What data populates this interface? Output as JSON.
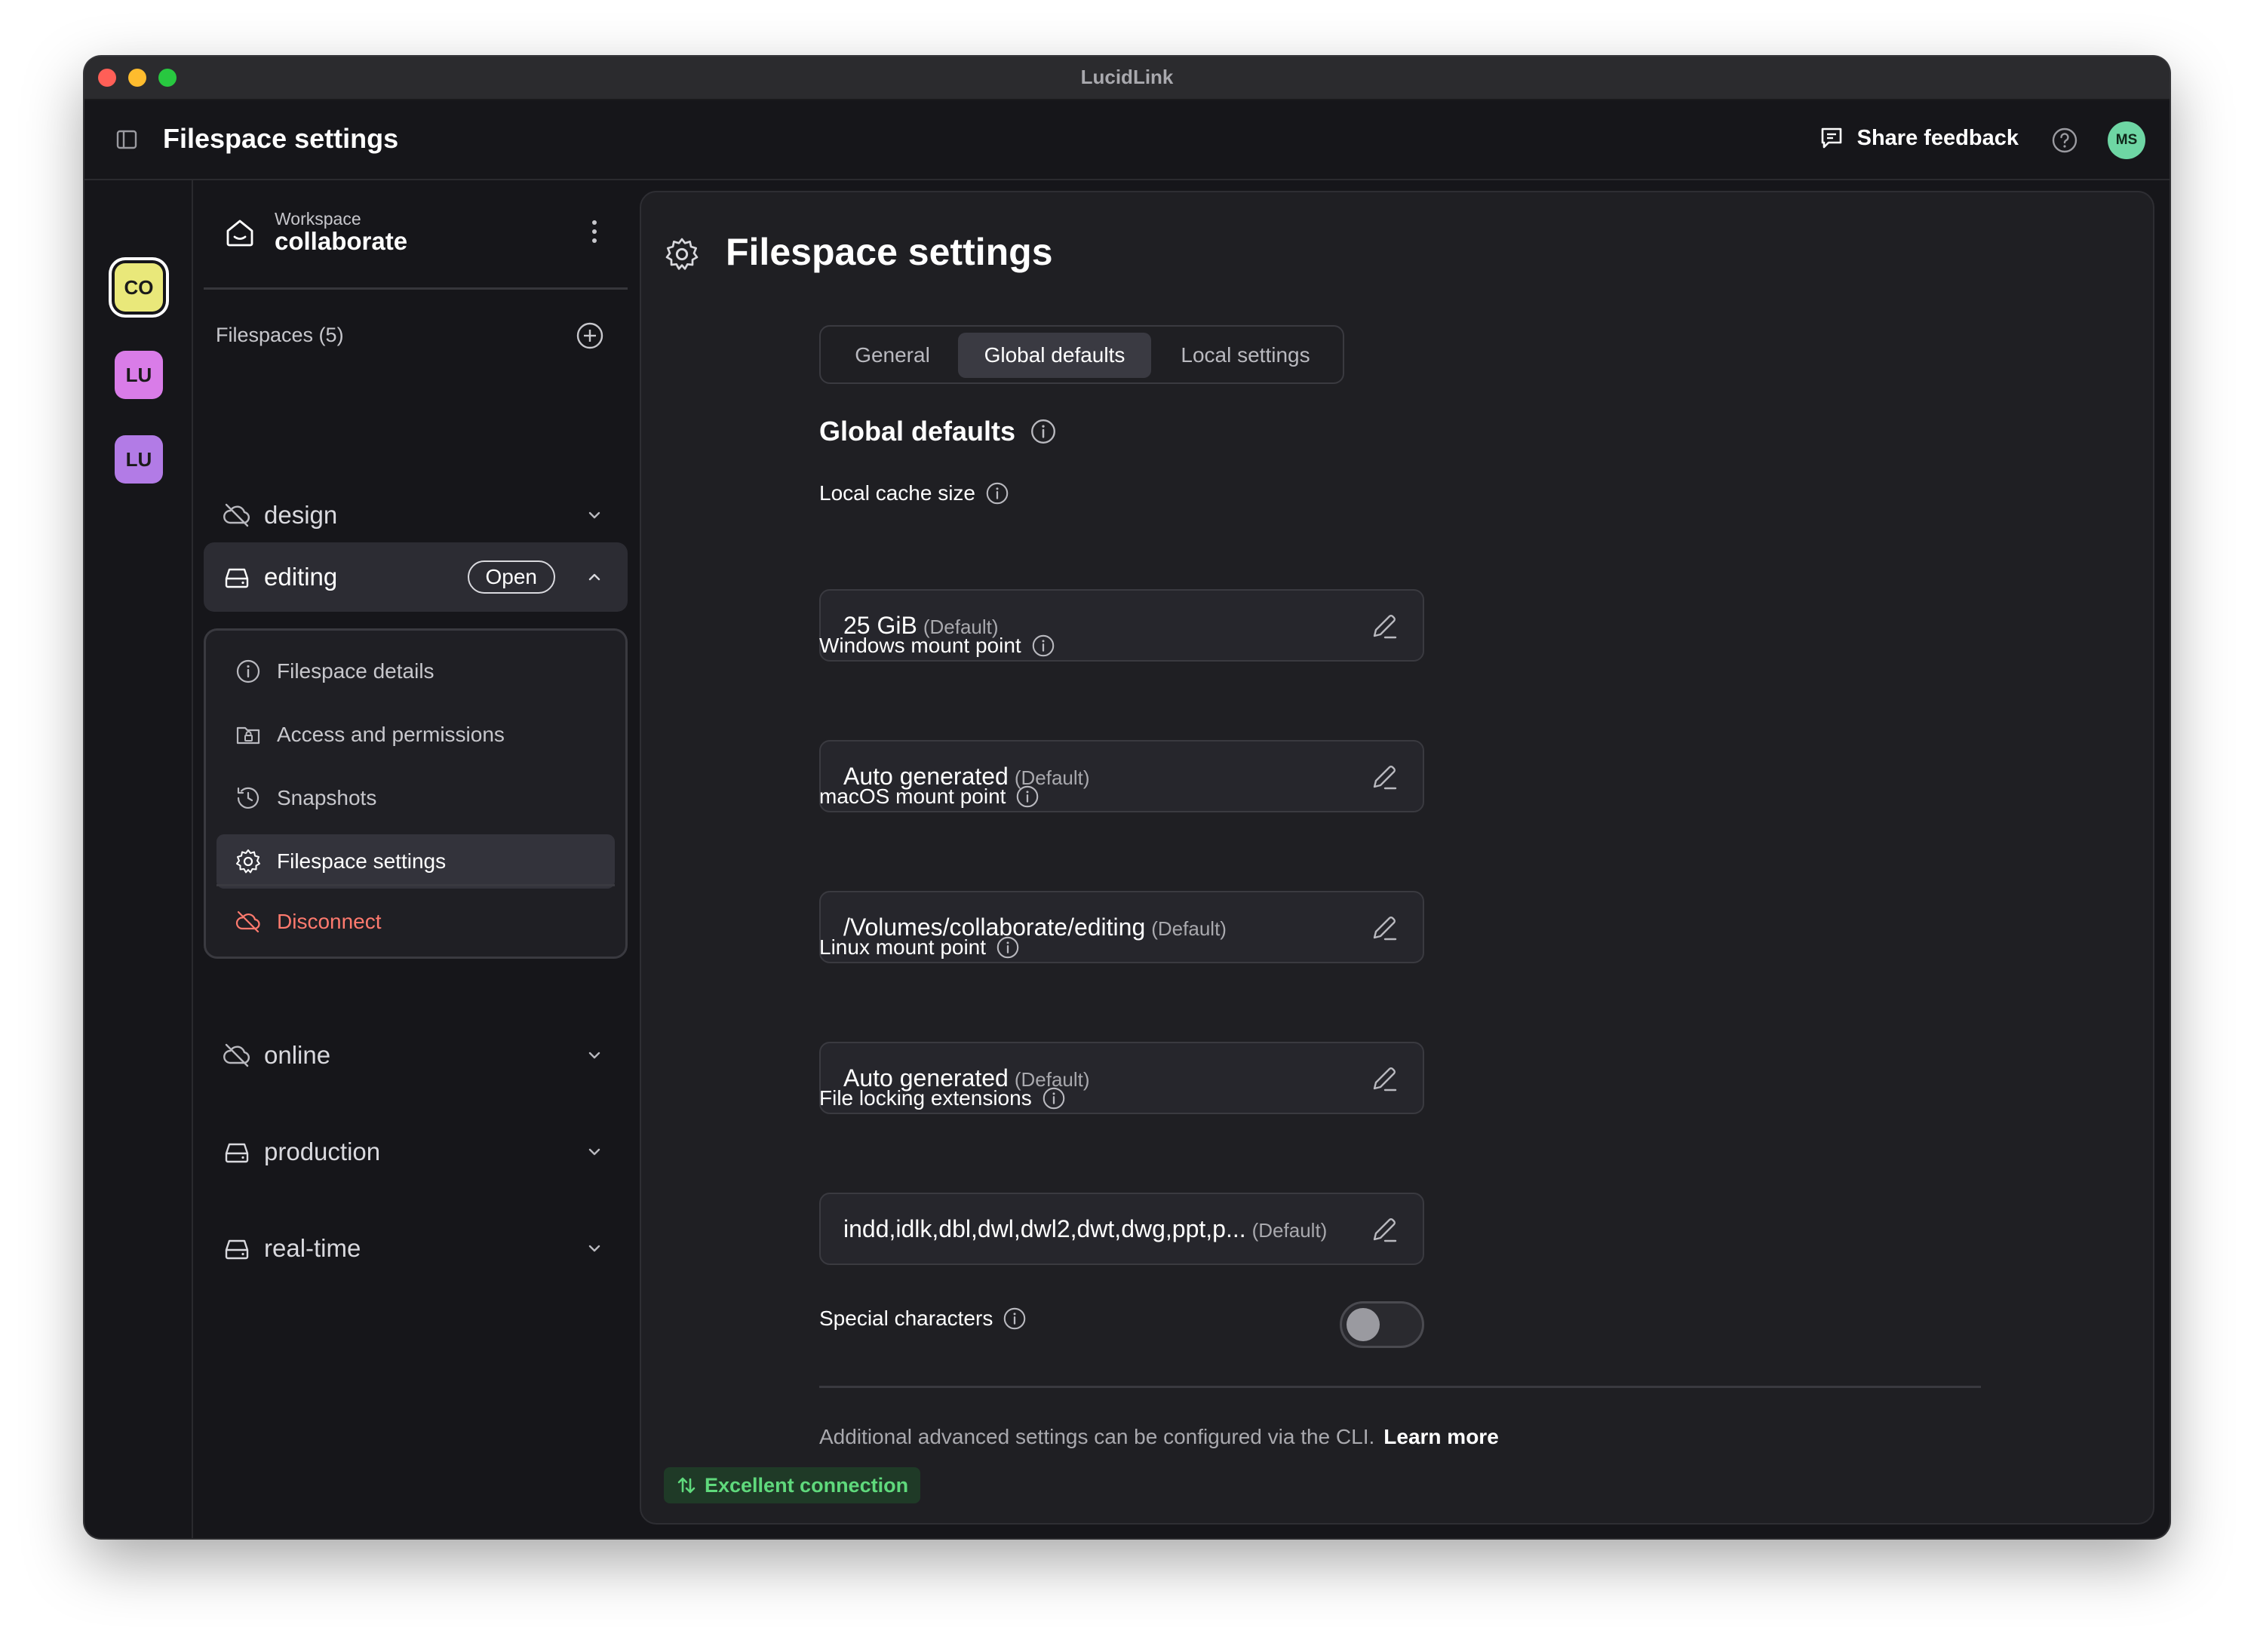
{
  "window": {
    "title": "LucidLink"
  },
  "header": {
    "title": "Filespace settings",
    "feedback_label": "Share feedback",
    "avatar_initials": "MS"
  },
  "workspaces": [
    {
      "initials": "CO",
      "color": "#e9e87a",
      "selected": true
    },
    {
      "initials": "LU",
      "color": "#d97ce8",
      "selected": false
    },
    {
      "initials": "LU",
      "color": "#b27be6",
      "selected": false
    }
  ],
  "sidebar": {
    "workspace_label": "Workspace",
    "workspace_name": "collaborate",
    "filespaces_label": "Filespaces (5)",
    "filespaces": [
      {
        "name": "design",
        "icon": "cloud-off-icon"
      },
      {
        "name": "editing",
        "icon": "drive-icon",
        "badge": "Open",
        "expanded": true
      },
      {
        "name": "online",
        "icon": "cloud-off-icon"
      },
      {
        "name": "production",
        "icon": "drive-icon"
      },
      {
        "name": "real-time",
        "icon": "drive-icon"
      }
    ],
    "submenu": [
      {
        "label": "Filespace details",
        "icon": "info-icon"
      },
      {
        "label": "Access and permissions",
        "icon": "folder-lock-icon"
      },
      {
        "label": "Snapshots",
        "icon": "clock-icon"
      },
      {
        "label": "Filespace settings",
        "icon": "gear-icon",
        "selected": true
      },
      {
        "label": "Disconnect",
        "icon": "cloud-off-icon",
        "danger": true
      }
    ]
  },
  "main": {
    "title": "Filespace settings",
    "tabs": [
      {
        "label": "General"
      },
      {
        "label": "Global defaults",
        "active": true
      },
      {
        "label": "Local settings"
      }
    ],
    "section_title": "Global defaults",
    "fields": [
      {
        "label": "Local cache size",
        "value": "25 GiB",
        "default_tag": "(Default)"
      },
      {
        "label": "Windows mount point",
        "value": "Auto generated",
        "default_tag": "(Default)"
      },
      {
        "label": "macOS mount point",
        "value": "/Volumes/collaborate/editing",
        "default_tag": "(Default)"
      },
      {
        "label": "Linux mount point",
        "value": "Auto generated",
        "default_tag": "(Default)"
      },
      {
        "label": "File locking extensions",
        "value": "indd,idlk,dbl,dwl,dwl2,dwt,dwg,ppt,p...",
        "default_tag": "(Default)"
      }
    ],
    "special_characters": {
      "label": "Special characters",
      "enabled": false
    },
    "cli_note": "Additional advanced settings can be configured via the CLI.",
    "learn_more": "Learn more",
    "connection_status": "Excellent connection"
  },
  "colors": {
    "accent_success": "#5fd97c",
    "danger": "#ff7a6e",
    "avatar": "#6ed6a4"
  }
}
